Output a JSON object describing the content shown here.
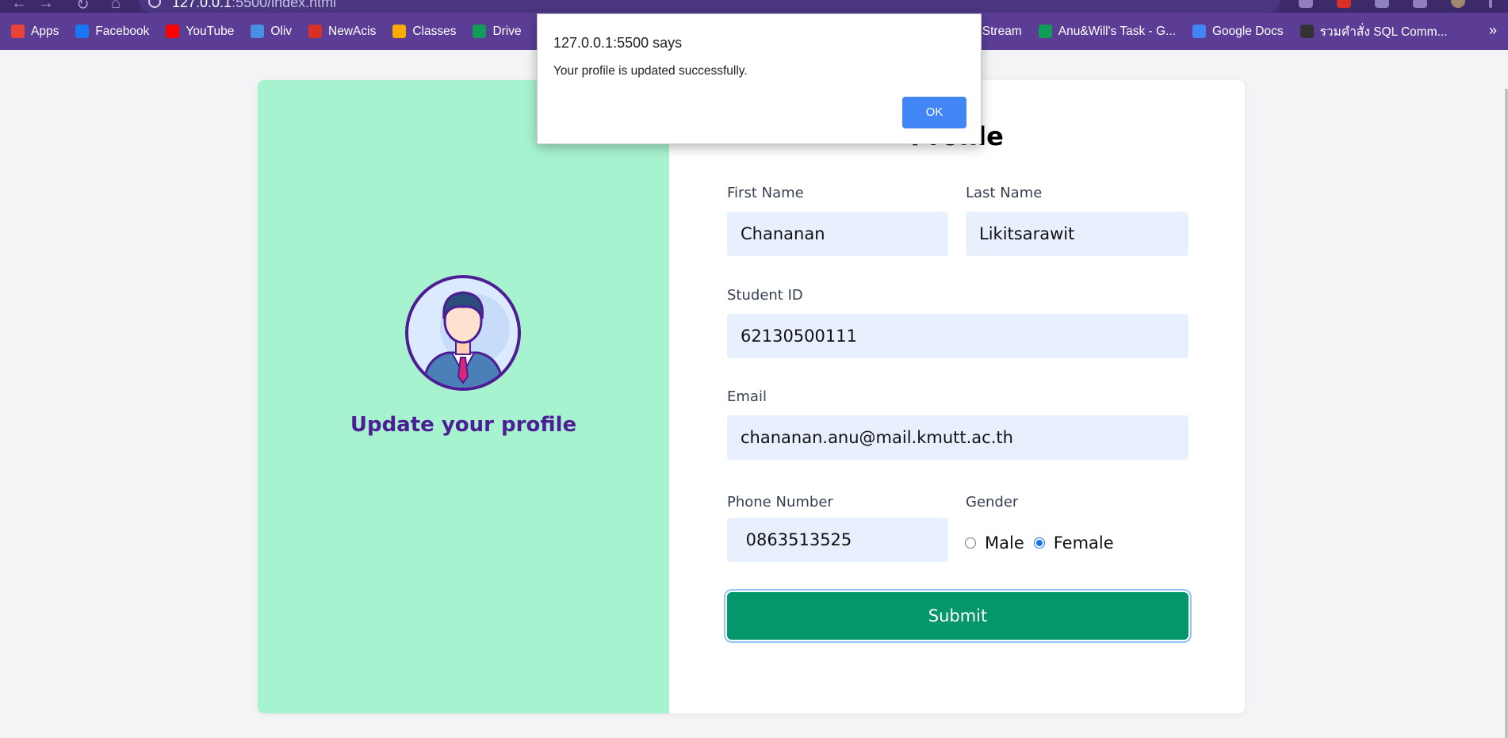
{
  "browser": {
    "url_host": "127.0.0.1",
    "url_rest": ":5500/index.html",
    "bookmarks": [
      {
        "label": "Apps",
        "icon": "apps-grid-icon",
        "color": "#ea4335"
      },
      {
        "label": "Facebook",
        "icon": "facebook-icon",
        "color": "#1877f2"
      },
      {
        "label": "YouTube",
        "icon": "youtube-icon",
        "color": "#ff0000"
      },
      {
        "label": "Oliv",
        "icon": "oliv-icon",
        "color": "#4a90e2"
      },
      {
        "label": "NewAcis",
        "icon": "newacis-icon",
        "color": "#d93025"
      },
      {
        "label": "Classes",
        "icon": "classroom-icon",
        "color": "#f9ab00"
      },
      {
        "label": "Drive",
        "icon": "drive-icon",
        "color": "#0f9d58"
      }
    ],
    "bookmarks_right": [
      {
        "label": "rt Stream",
        "icon": "",
        "color": ""
      },
      {
        "label": "Anu&Will's Task - G...",
        "icon": "sheets-icon",
        "color": "#0f9d58"
      },
      {
        "label": "Google Docs",
        "icon": "google-icon",
        "color": "#4285f4"
      },
      {
        "label": "รวมคำสั่ง SQL Comm...",
        "icon": "s-link-icon",
        "color": "#333333"
      }
    ]
  },
  "profile_panel": {
    "title": "Update your profile"
  },
  "form": {
    "title": "Profile",
    "first_name_label": "First Name",
    "first_name_value": "Chananan",
    "last_name_label": "Last Name",
    "last_name_value": "Likitsarawit",
    "student_id_label": "Student ID",
    "student_id_value": "62130500111",
    "email_label": "Email",
    "email_value": "chananan.anu@mail.kmutt.ac.th",
    "phone_label": "Phone Number",
    "phone_value": " 0863513525",
    "gender_label": "Gender",
    "gender_options": [
      "Male",
      "Female"
    ],
    "gender_selected": "Female",
    "submit_label": "Submit"
  },
  "dialog": {
    "title": "127.0.0.1:5500 says",
    "message": "Your profile is updated successfully.",
    "ok_label": "OK"
  },
  "colors": {
    "browser_frame": "#5b3d96",
    "left_panel": "#a7f3d0",
    "accent_purple": "#4c1d95",
    "submit_green": "#059669",
    "input_fill": "#e8f0fe",
    "dialog_button": "#4285f4"
  }
}
